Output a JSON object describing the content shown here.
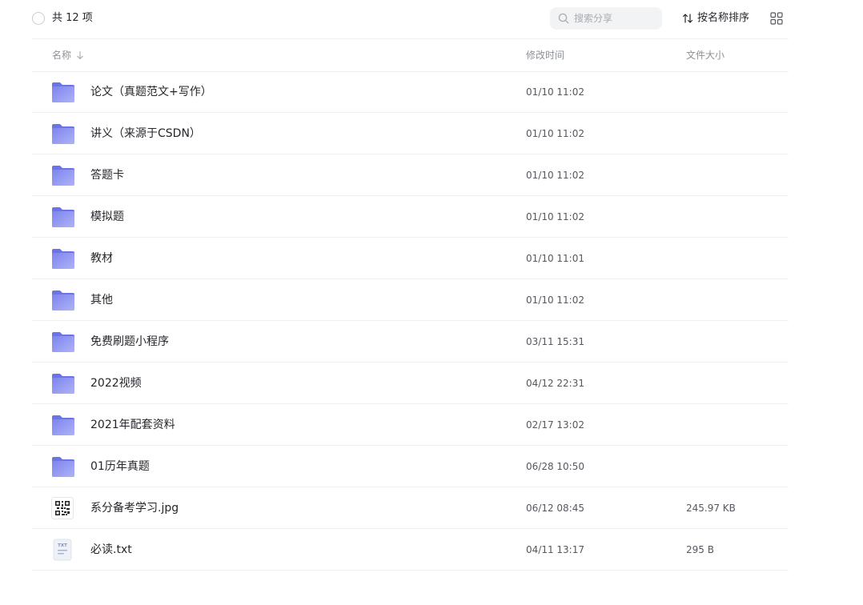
{
  "toolbar": {
    "count_label": "共 12 项",
    "search_placeholder": "搜索分享",
    "sort_label": "按名称排序"
  },
  "columns": {
    "name": "名称",
    "modified": "修改时间",
    "size": "文件大小"
  },
  "colors": {
    "folder": "#8e94ef",
    "divider": "#eef0f3",
    "muted": "#8c9096"
  },
  "files": [
    {
      "name": "论文（真题范文+写作）",
      "modified": "01/10 11:02",
      "size": "",
      "icon": "folder-icon"
    },
    {
      "name": "讲义（来源于CSDN）",
      "modified": "01/10 11:02",
      "size": "",
      "icon": "folder-icon"
    },
    {
      "name": "答题卡",
      "modified": "01/10 11:02",
      "size": "",
      "icon": "folder-icon"
    },
    {
      "name": "模拟题",
      "modified": "01/10 11:02",
      "size": "",
      "icon": "folder-icon"
    },
    {
      "name": "教材",
      "modified": "01/10 11:01",
      "size": "",
      "icon": "folder-icon"
    },
    {
      "name": "其他",
      "modified": "01/10 11:02",
      "size": "",
      "icon": "folder-icon"
    },
    {
      "name": "免费刷题小程序",
      "modified": "03/11 15:31",
      "size": "",
      "icon": "folder-icon"
    },
    {
      "name": "2022视频",
      "modified": "04/12 22:31",
      "size": "",
      "icon": "folder-icon"
    },
    {
      "name": "2021年配套资料",
      "modified": "02/17 13:02",
      "size": "",
      "icon": "folder-icon"
    },
    {
      "name": "01历年真题",
      "modified": "06/28 10:50",
      "size": "",
      "icon": "folder-icon"
    },
    {
      "name": "系分备考学习.jpg",
      "modified": "06/12 08:45",
      "size": "245.97 KB",
      "icon": "image-file-icon"
    },
    {
      "name": "必读.txt",
      "modified": "04/11 13:17",
      "size": "295 B",
      "icon": "txt-file-icon",
      "icon_text": "TXT"
    }
  ]
}
